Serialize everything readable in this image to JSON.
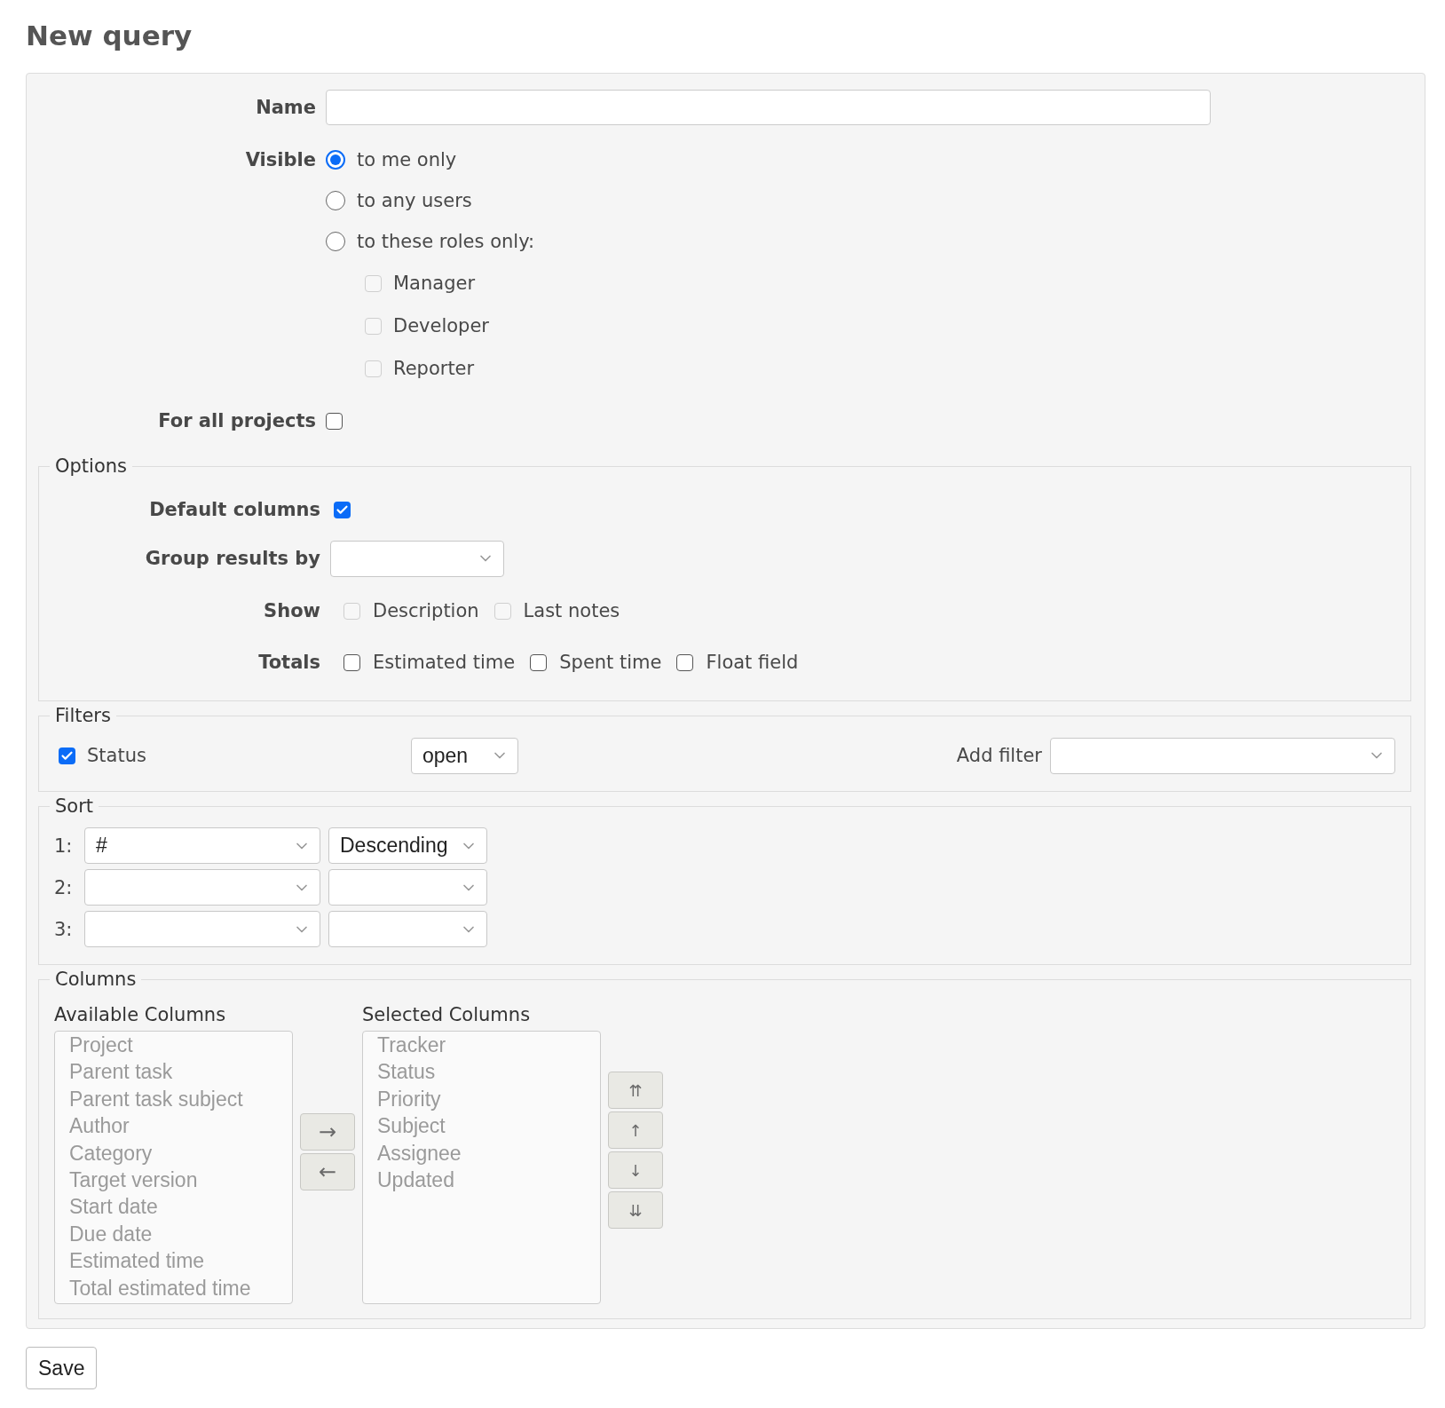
{
  "page_title": "New query",
  "name_field": {
    "label": "Name"
  },
  "visible": {
    "label": "Visible",
    "options": [
      {
        "label": "to me only",
        "selected": true
      },
      {
        "label": "to any users",
        "selected": false
      },
      {
        "label": "to these roles only:",
        "selected": false
      }
    ],
    "roles": [
      {
        "label": "Manager",
        "checked": false,
        "disabled": true
      },
      {
        "label": "Developer",
        "checked": false,
        "disabled": true
      },
      {
        "label": "Reporter",
        "checked": false,
        "disabled": true
      }
    ]
  },
  "for_all_projects": {
    "label": "For all projects",
    "checked": false
  },
  "options": {
    "legend": "Options",
    "default_columns": {
      "label": "Default columns",
      "checked": true
    },
    "group_results_by": {
      "label": "Group results by"
    },
    "show": {
      "label": "Show",
      "items": [
        {
          "label": "Description",
          "checked": false,
          "disabled": true
        },
        {
          "label": "Last notes",
          "checked": false,
          "disabled": true
        }
      ]
    },
    "totals": {
      "label": "Totals",
      "items": [
        {
          "label": "Estimated time",
          "checked": false,
          "disabled": false
        },
        {
          "label": "Spent time",
          "checked": false,
          "disabled": false
        },
        {
          "label": "Float field",
          "checked": false,
          "disabled": false
        }
      ]
    }
  },
  "filters": {
    "legend": "Filters",
    "items": [
      {
        "label": "Status",
        "checked": true,
        "operator": "open"
      }
    ],
    "add_filter": {
      "label": "Add filter"
    }
  },
  "sort": {
    "legend": "Sort",
    "rows": [
      {
        "index": "1:",
        "field": "#",
        "order": "Descending"
      },
      {
        "index": "2:"
      },
      {
        "index": "3:"
      }
    ]
  },
  "columns": {
    "legend": "Columns",
    "disabled": true,
    "available": {
      "label": "Available Columns",
      "items": [
        "Project",
        "Parent task",
        "Parent task subject",
        "Author",
        "Category",
        "Target version",
        "Start date",
        "Due date",
        "Estimated time",
        "Total estimated time"
      ]
    },
    "selected": {
      "label": "Selected Columns",
      "items": [
        "Tracker",
        "Status",
        "Priority",
        "Subject",
        "Assignee",
        "Updated"
      ]
    },
    "move_buttons": [
      "→",
      "←"
    ],
    "order_buttons": [
      "⇈",
      "↑",
      "↓",
      "⇊"
    ]
  },
  "save_button": "Save"
}
